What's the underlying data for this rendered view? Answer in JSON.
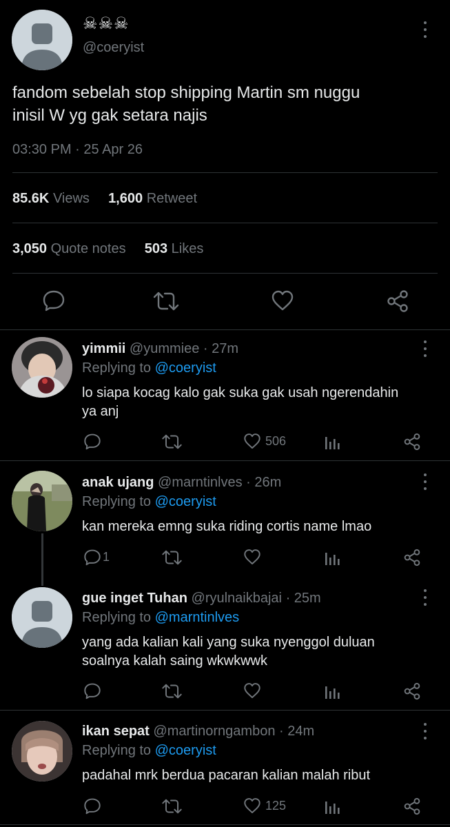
{
  "main_tweet": {
    "display_name": "☠︎☠︎☠︎",
    "handle": "@coeryist",
    "text_line1": "fandom sebelah stop shipping Martin sm nuggu",
    "text_line2": "inisil W yg gak setara najis",
    "timestamp": "03:30 PM · 25 Apr 26",
    "views_count": "85.6K",
    "views_label": "Views",
    "retweet_count": "1,600",
    "retweet_label": "Retweet",
    "quote_count": "3,050",
    "quote_label": "Quote notes",
    "likes_count": "503",
    "likes_label": "Likes"
  },
  "replies": [
    {
      "name": "yimmii",
      "handle": "@yummiee",
      "time": "· 27m",
      "replying_label": "Replying to",
      "replying_to": "@coeryist",
      "line1": "lo siapa kocag kalo gak suka gak usah ngerendahin",
      "line2": "ya anj",
      "reply_count": "",
      "like_count": "506"
    },
    {
      "name": "anak ujang",
      "handle": "@marntinlves",
      "time": "· 26m",
      "replying_label": "Replying to",
      "replying_to": "@coeryist",
      "line1": "kan mereka emng suka riding cortis name lmao",
      "line2": "",
      "reply_count": "1",
      "like_count": ""
    },
    {
      "name": "gue inget Tuhan",
      "handle": "@ryulnaikbajai",
      "time": "· 25m",
      "replying_label": "Replying to",
      "replying_to": "@marntinlves",
      "line1": "yang ada kalian kali yang suka nyenggol duluan",
      "line2": "soalnya kalah saing wkwkwwk",
      "reply_count": "",
      "like_count": ""
    },
    {
      "name": "ikan sepat",
      "handle": "@martinorngambon",
      "time": "· 24m",
      "replying_label": "Replying to",
      "replying_to": "@coeryist",
      "line1": "padahal mrk berdua pacaran kalian malah ribut",
      "line2": "",
      "reply_count": "",
      "like_count": "125"
    }
  ],
  "colors": {
    "background": "#000000",
    "text": "#e7e9ea",
    "secondary": "#71767b",
    "accent": "#1d9bf0",
    "divider": "#2f3336"
  },
  "icons": [
    "comment-icon",
    "retweet-icon",
    "heart-icon",
    "share-icon",
    "stats-icon",
    "more-icon"
  ]
}
